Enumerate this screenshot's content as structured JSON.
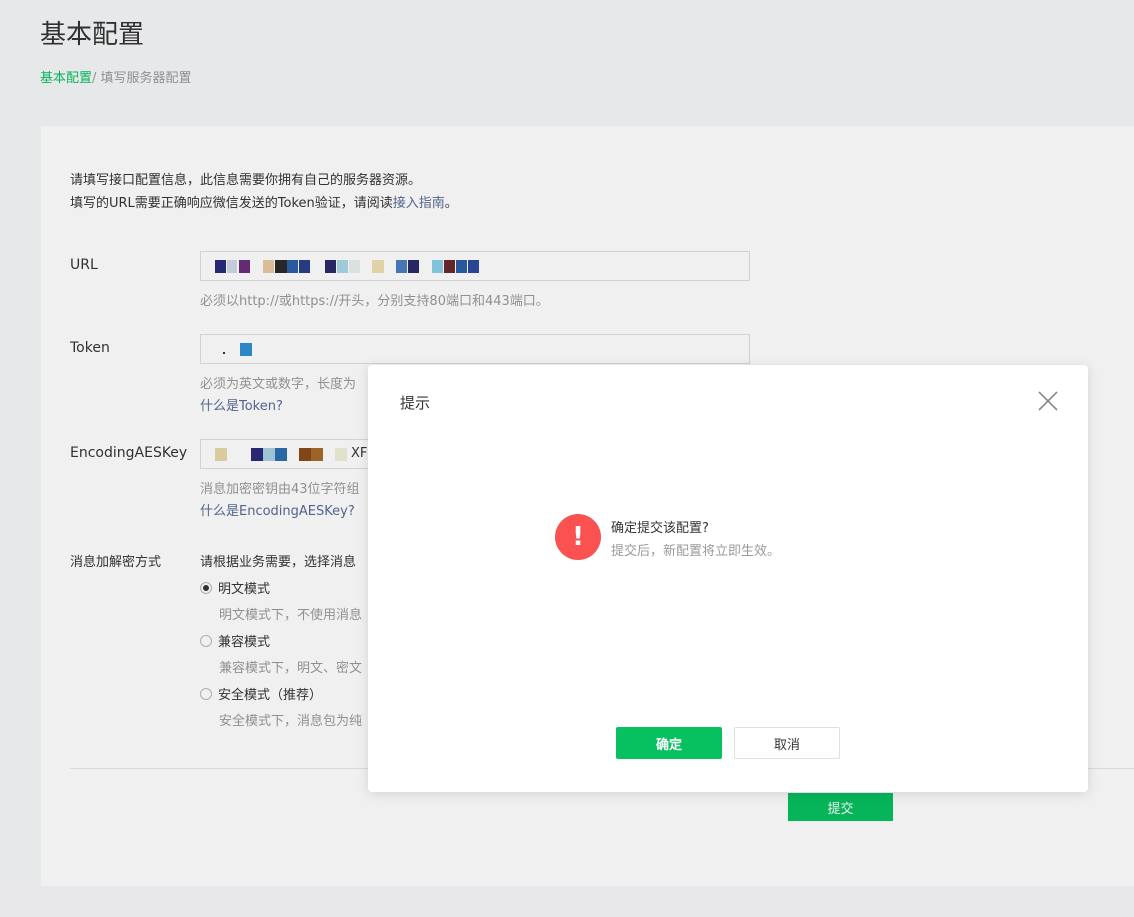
{
  "page": {
    "title": "基本配置",
    "breadcrumb": {
      "link": "基本配置",
      "separator": "/",
      "current": "填写服务器配置"
    }
  },
  "intro": {
    "line1": "请填写接口配置信息，此信息需要你拥有自己的服务器资源。",
    "line2_prefix": "填写的URL需要正确响应微信发送的Token验证，请阅读",
    "line2_link": "接入指南",
    "line2_suffix": "。"
  },
  "form": {
    "url": {
      "label": "URL",
      "hint": "必须以http://或https://开头，分别支持80端口和443端口。"
    },
    "token": {
      "label": "Token",
      "hint": "必须为英文或数字，长度为",
      "help": "什么是Token?"
    },
    "aes": {
      "label": "EncodingAESKey",
      "value_visible": "XF",
      "hint": "消息加密密钥由43位字符组",
      "help": "什么是EncodingAESKey?"
    },
    "encryption": {
      "label": "消息加解密方式",
      "hint": "请根据业务需要，选择消息",
      "options": [
        {
          "label": "明文模式",
          "desc": "明文模式下，不使用消息",
          "checked": true
        },
        {
          "label": "兼容模式",
          "desc": "兼容模式下，明文、密文",
          "checked": false
        },
        {
          "label": "安全模式（推荐）",
          "desc": "安全模式下，消息包为纯",
          "checked": false
        }
      ]
    },
    "submit_label": "提交"
  },
  "dialog": {
    "title": "提示",
    "message": "确定提交该配置?",
    "submessage": "提交后，新配置将立即生效。",
    "ok_label": "确定",
    "cancel_label": "取消",
    "warn_glyph": "!"
  },
  "colors": {
    "accent": "#07c160",
    "link": "#576b95",
    "warning": "#fa5151"
  }
}
